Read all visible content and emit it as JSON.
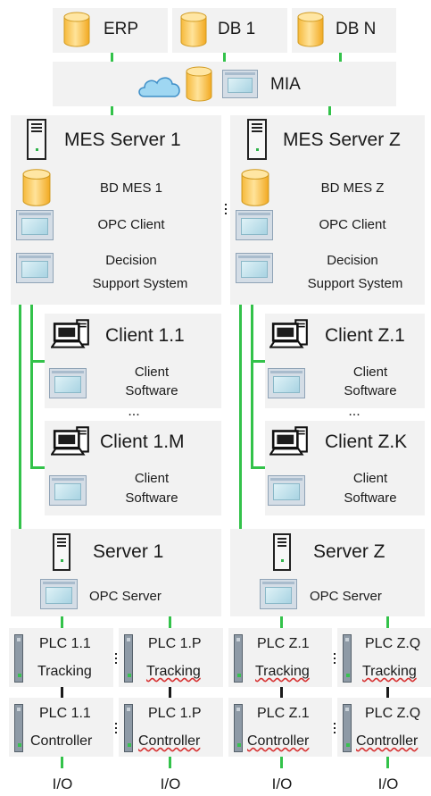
{
  "top": {
    "erp": "ERP",
    "db1": "DB 1",
    "dbn": "DB N"
  },
  "mia": {
    "label": "MIA"
  },
  "mes": [
    {
      "server": "MES Server 1",
      "db": "BD MES 1",
      "opc_client": "OPC Client",
      "dss_line1": "Decision",
      "dss_line2": "Support System"
    },
    {
      "server": "MES Server Z",
      "db": "BD MES Z",
      "opc_client": "OPC Client",
      "dss_line1": "Decision",
      "dss_line2": "Support System"
    }
  ],
  "clients": [
    [
      {
        "name": "Client 1.1",
        "sw1": "Client",
        "sw2": "Software"
      },
      {
        "name": "Client 1.M",
        "sw1": "Client",
        "sw2": "Software"
      }
    ],
    [
      {
        "name": "Client Z.1",
        "sw1": "Client",
        "sw2": "Software"
      },
      {
        "name": "Client Z.K",
        "sw1": "Client",
        "sw2": "Software"
      }
    ]
  ],
  "ellipsis": "...",
  "servers": [
    {
      "name": "Server 1",
      "opc": "OPC Server"
    },
    {
      "name": "Server Z",
      "opc": "OPC Server"
    }
  ],
  "plc_tracking": [
    {
      "name": "PLC 1.1",
      "role": "Tracking"
    },
    {
      "name": "PLC 1.P",
      "role": "Tracking"
    },
    {
      "name": "PLC Z.1",
      "role": "Tracking"
    },
    {
      "name": "PLC Z.Q",
      "role": "Tracking"
    }
  ],
  "plc_controller": [
    {
      "name": "PLC 1.1",
      "role": "Controller"
    },
    {
      "name": "PLC 1.P",
      "role": "Controller"
    },
    {
      "name": "PLC Z.1",
      "role": "Controller"
    },
    {
      "name": "PLC Z.Q",
      "role": "Controller"
    }
  ],
  "io": [
    "I/O",
    "I/O",
    "I/O",
    "I/O"
  ],
  "colors": {
    "box": "#f2f2f2",
    "link_green": "#33c24a",
    "link_black": "#1a1a1a",
    "db_yellow": "#f5c04a"
  }
}
